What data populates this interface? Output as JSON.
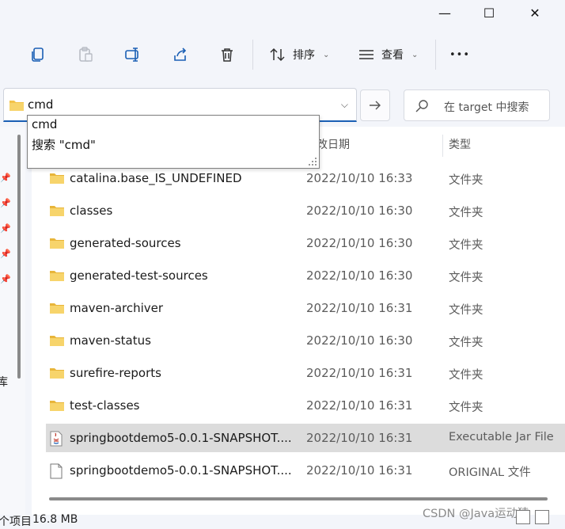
{
  "window": {
    "minimize_glyph": "—",
    "maximize_glyph": "☐",
    "close_glyph": "✕"
  },
  "toolbar": {
    "sort_label": "排序",
    "view_label": "查看",
    "more_label": "•••"
  },
  "address_bar": {
    "value": "cmd"
  },
  "search": {
    "placeholder": "在 target 中搜索"
  },
  "autocomplete": {
    "items": [
      "cmd",
      "搜索 \"cmd\""
    ]
  },
  "nav": {
    "partial_label": "库"
  },
  "columns": {
    "date_partial": "改日期",
    "type": "类型"
  },
  "files": [
    {
      "name": "catalina.base_IS_UNDEFINED",
      "date": "2022/10/10 16:33",
      "type": "文件夹",
      "icon": "folder-icon"
    },
    {
      "name": "classes",
      "date": "2022/10/10 16:30",
      "type": "文件夹",
      "icon": "folder-icon"
    },
    {
      "name": "generated-sources",
      "date": "2022/10/10 16:30",
      "type": "文件夹",
      "icon": "folder-icon"
    },
    {
      "name": "generated-test-sources",
      "date": "2022/10/10 16:30",
      "type": "文件夹",
      "icon": "folder-icon"
    },
    {
      "name": "maven-archiver",
      "date": "2022/10/10 16:31",
      "type": "文件夹",
      "icon": "folder-icon"
    },
    {
      "name": "maven-status",
      "date": "2022/10/10 16:30",
      "type": "文件夹",
      "icon": "folder-icon"
    },
    {
      "name": "surefire-reports",
      "date": "2022/10/10 16:31",
      "type": "文件夹",
      "icon": "folder-icon"
    },
    {
      "name": "test-classes",
      "date": "2022/10/10 16:31",
      "type": "文件夹",
      "icon": "folder-icon"
    },
    {
      "name": "springbootdemo5-0.0.1-SNAPSHOT....",
      "date": "2022/10/10 16:31",
      "type": "Executable Jar File",
      "icon": "jar-file-icon"
    },
    {
      "name": "springbootdemo5-0.0.1-SNAPSHOT....",
      "date": "2022/10/10 16:31",
      "type": "ORIGINAL 文件",
      "icon": "file-icon"
    }
  ],
  "status": {
    "count_partial": "个项目",
    "size": "16.8 MB"
  },
  "watermark": "CSDN @Java运动猿",
  "colors": {
    "folder": "#f3c34a",
    "accent": "#1a5fb4",
    "selected_row": "#dcdcdc"
  }
}
